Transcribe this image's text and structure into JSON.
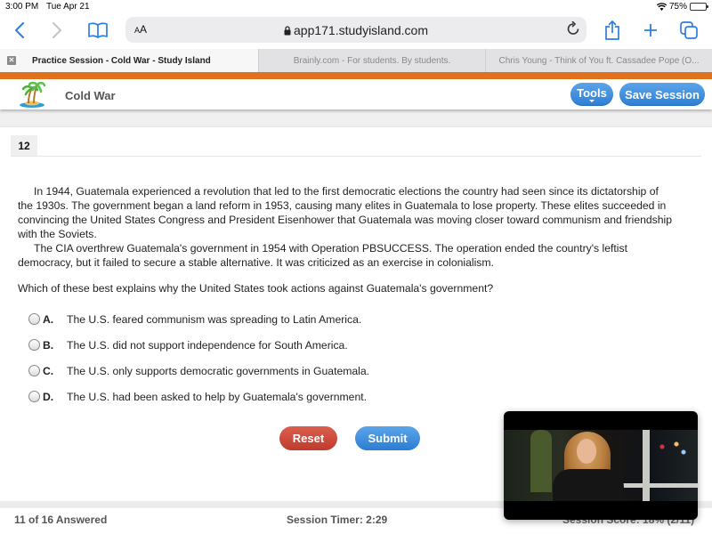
{
  "status_bar": {
    "time": "3:00 PM",
    "date": "Tue Apr 21",
    "battery": "75%",
    "battery_level": 0.75
  },
  "browser": {
    "url": "app171.studyisland.com",
    "text_size_label_small": "A",
    "text_size_label_large": "A",
    "tabs": [
      {
        "title": "Practice Session - Cold War - Study Island",
        "active": true
      },
      {
        "title": "Brainly.com - For students. By students.",
        "active": false
      },
      {
        "title": "Chris Young - Think of You ft. Cassadee Pope (O...",
        "active": false
      }
    ],
    "close_tab_glyph": "✕"
  },
  "app": {
    "title": "Cold War",
    "tools_label": "Tools",
    "save_session_label": "Save Session",
    "accent_color": "#2c7fd4",
    "brand_bar_color": "#e2711d"
  },
  "question": {
    "number": "12",
    "passage": [
      "In 1944, Guatemala experienced a revolution that led to the first democratic elections the country had seen since its dictatorship of the 1930s. The government began a land reform in 1953, causing many elites in Guatemala to lose property. These elites succeeded in convincing the United States Congress and President Eisenhower that Guatemala was moving closer toward communism and friendship with the Soviets.",
      "The CIA overthrew Guatemala's government in 1954 with Operation PBSUCCESS. The operation ended the country's leftist democracy, but it failed to secure a stable alternative. It was criticized as an exercise in colonialism."
    ],
    "prompt": "Which of these best explains why the United States took actions against Guatemala's government?",
    "choices": [
      {
        "letter": "A.",
        "text": "The U.S. feared communism was spreading to Latin America."
      },
      {
        "letter": "B.",
        "text": "The U.S. did not support independence for South America."
      },
      {
        "letter": "C.",
        "text": "The U.S. only supports democratic governments in Guatemala."
      },
      {
        "letter": "D.",
        "text": "The U.S. had been asked to help by Guatemala's government."
      }
    ],
    "reset_label": "Reset",
    "submit_label": "Submit"
  },
  "footer": {
    "answered": "11 of 16 Answered",
    "timer": "Session Timer: 2:29",
    "score": "Session Score: 18% (2/11)"
  }
}
